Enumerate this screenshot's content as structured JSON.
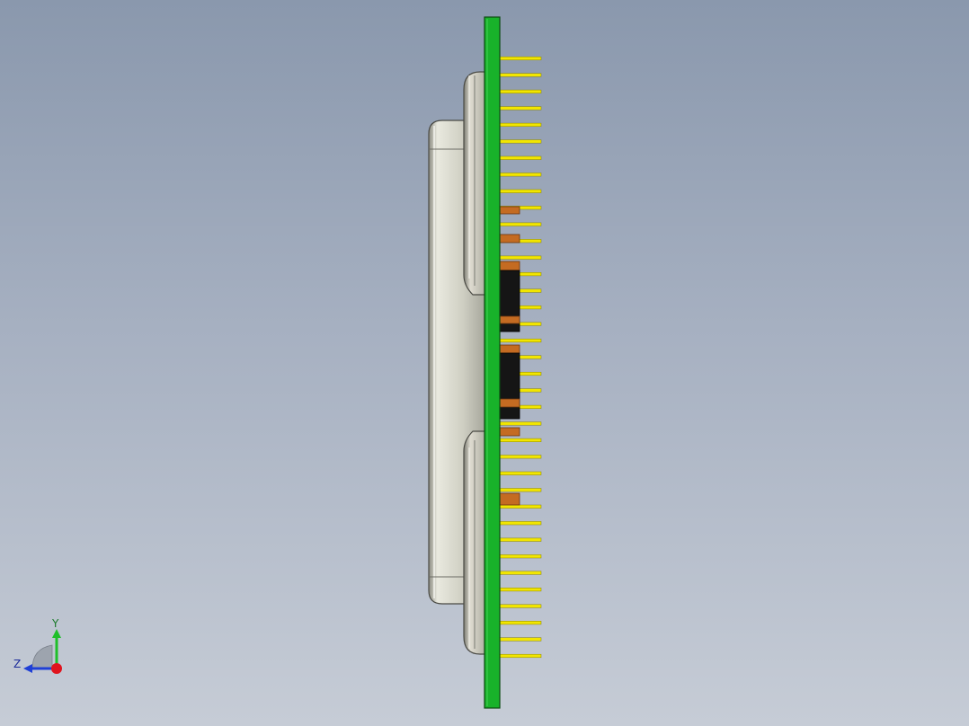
{
  "viewport": {
    "background_top": "#8a98ad",
    "background_bottom": "#c6ccd6"
  },
  "model": {
    "pcb_color": "#18b22a",
    "pin_color": "#f2e600",
    "housing_color": "#c9c9bd",
    "component_color": "#c46b22",
    "ic_color": "#151515",
    "pin_count": 37
  },
  "triad": {
    "y_label": "Y",
    "z_label": "Z",
    "y_color": "#1fbf2a",
    "z_color": "#1f3fd6",
    "origin_color": "#e0141e"
  }
}
